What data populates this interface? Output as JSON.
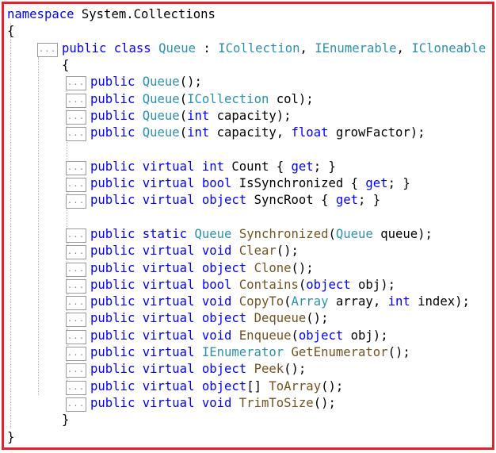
{
  "colors": {
    "keyword": "#0000ff",
    "type": "#2b91af",
    "method": "#74531f",
    "plain": "#000000",
    "border": "#e0242b"
  },
  "lines": [
    {
      "indent": 0,
      "fold": false,
      "tokens": [
        {
          "t": "namespace",
          "c": "keyword"
        },
        {
          "t": " System.Collections",
          "c": "plain"
        }
      ]
    },
    {
      "indent": 0,
      "fold": false,
      "tokens": [
        {
          "t": "{",
          "c": "plain"
        }
      ]
    },
    {
      "indent": 1,
      "fold": true,
      "tokens": [
        {
          "t": "public",
          "c": "keyword"
        },
        {
          "t": " ",
          "c": "plain"
        },
        {
          "t": "class",
          "c": "keyword"
        },
        {
          "t": " ",
          "c": "plain"
        },
        {
          "t": "Queue",
          "c": "type"
        },
        {
          "t": " : ",
          "c": "plain"
        },
        {
          "t": "ICollection",
          "c": "type"
        },
        {
          "t": ", ",
          "c": "plain"
        },
        {
          "t": "IEnumerable",
          "c": "type"
        },
        {
          "t": ", ",
          "c": "plain"
        },
        {
          "t": "ICloneable",
          "c": "type"
        }
      ]
    },
    {
      "indent": 1,
      "fold": false,
      "tokens": [
        {
          "t": "{",
          "c": "plain"
        }
      ]
    },
    {
      "indent": 2,
      "fold": true,
      "tokens": [
        {
          "t": "public",
          "c": "keyword"
        },
        {
          "t": " ",
          "c": "plain"
        },
        {
          "t": "Queue",
          "c": "type"
        },
        {
          "t": "();",
          "c": "plain"
        }
      ]
    },
    {
      "indent": 2,
      "fold": true,
      "tokens": [
        {
          "t": "public",
          "c": "keyword"
        },
        {
          "t": " ",
          "c": "plain"
        },
        {
          "t": "Queue",
          "c": "type"
        },
        {
          "t": "(",
          "c": "plain"
        },
        {
          "t": "ICollection",
          "c": "type"
        },
        {
          "t": " col);",
          "c": "plain"
        }
      ]
    },
    {
      "indent": 2,
      "fold": true,
      "tokens": [
        {
          "t": "public",
          "c": "keyword"
        },
        {
          "t": " ",
          "c": "plain"
        },
        {
          "t": "Queue",
          "c": "type"
        },
        {
          "t": "(",
          "c": "plain"
        },
        {
          "t": "int",
          "c": "keyword"
        },
        {
          "t": " capacity);",
          "c": "plain"
        }
      ]
    },
    {
      "indent": 2,
      "fold": true,
      "tokens": [
        {
          "t": "public",
          "c": "keyword"
        },
        {
          "t": " ",
          "c": "plain"
        },
        {
          "t": "Queue",
          "c": "type"
        },
        {
          "t": "(",
          "c": "plain"
        },
        {
          "t": "int",
          "c": "keyword"
        },
        {
          "t": " capacity, ",
          "c": "plain"
        },
        {
          "t": "float",
          "c": "keyword"
        },
        {
          "t": " growFactor);",
          "c": "plain"
        }
      ]
    },
    {
      "indent": 2,
      "fold": false,
      "tokens": []
    },
    {
      "indent": 2,
      "fold": true,
      "tokens": [
        {
          "t": "public",
          "c": "keyword"
        },
        {
          "t": " ",
          "c": "plain"
        },
        {
          "t": "virtual",
          "c": "keyword"
        },
        {
          "t": " ",
          "c": "plain"
        },
        {
          "t": "int",
          "c": "keyword"
        },
        {
          "t": " Count { ",
          "c": "plain"
        },
        {
          "t": "get",
          "c": "keyword"
        },
        {
          "t": "; }",
          "c": "plain"
        }
      ]
    },
    {
      "indent": 2,
      "fold": true,
      "tokens": [
        {
          "t": "public",
          "c": "keyword"
        },
        {
          "t": " ",
          "c": "plain"
        },
        {
          "t": "virtual",
          "c": "keyword"
        },
        {
          "t": " ",
          "c": "plain"
        },
        {
          "t": "bool",
          "c": "keyword"
        },
        {
          "t": " IsSynchronized { ",
          "c": "plain"
        },
        {
          "t": "get",
          "c": "keyword"
        },
        {
          "t": "; }",
          "c": "plain"
        }
      ]
    },
    {
      "indent": 2,
      "fold": true,
      "tokens": [
        {
          "t": "public",
          "c": "keyword"
        },
        {
          "t": " ",
          "c": "plain"
        },
        {
          "t": "virtual",
          "c": "keyword"
        },
        {
          "t": " ",
          "c": "plain"
        },
        {
          "t": "object",
          "c": "keyword"
        },
        {
          "t": " SyncRoot { ",
          "c": "plain"
        },
        {
          "t": "get",
          "c": "keyword"
        },
        {
          "t": "; }",
          "c": "plain"
        }
      ]
    },
    {
      "indent": 2,
      "fold": false,
      "tokens": []
    },
    {
      "indent": 2,
      "fold": true,
      "tokens": [
        {
          "t": "public",
          "c": "keyword"
        },
        {
          "t": " ",
          "c": "plain"
        },
        {
          "t": "static",
          "c": "keyword"
        },
        {
          "t": " ",
          "c": "plain"
        },
        {
          "t": "Queue",
          "c": "type"
        },
        {
          "t": " ",
          "c": "plain"
        },
        {
          "t": "Synchronized",
          "c": "method"
        },
        {
          "t": "(",
          "c": "plain"
        },
        {
          "t": "Queue",
          "c": "type"
        },
        {
          "t": " queue);",
          "c": "plain"
        }
      ]
    },
    {
      "indent": 2,
      "fold": true,
      "tokens": [
        {
          "t": "public",
          "c": "keyword"
        },
        {
          "t": " ",
          "c": "plain"
        },
        {
          "t": "virtual",
          "c": "keyword"
        },
        {
          "t": " ",
          "c": "plain"
        },
        {
          "t": "void",
          "c": "keyword"
        },
        {
          "t": " ",
          "c": "plain"
        },
        {
          "t": "Clear",
          "c": "method"
        },
        {
          "t": "();",
          "c": "plain"
        }
      ]
    },
    {
      "indent": 2,
      "fold": true,
      "tokens": [
        {
          "t": "public",
          "c": "keyword"
        },
        {
          "t": " ",
          "c": "plain"
        },
        {
          "t": "virtual",
          "c": "keyword"
        },
        {
          "t": " ",
          "c": "plain"
        },
        {
          "t": "object",
          "c": "keyword"
        },
        {
          "t": " ",
          "c": "plain"
        },
        {
          "t": "Clone",
          "c": "method"
        },
        {
          "t": "();",
          "c": "plain"
        }
      ]
    },
    {
      "indent": 2,
      "fold": true,
      "tokens": [
        {
          "t": "public",
          "c": "keyword"
        },
        {
          "t": " ",
          "c": "plain"
        },
        {
          "t": "virtual",
          "c": "keyword"
        },
        {
          "t": " ",
          "c": "plain"
        },
        {
          "t": "bool",
          "c": "keyword"
        },
        {
          "t": " ",
          "c": "plain"
        },
        {
          "t": "Contains",
          "c": "method"
        },
        {
          "t": "(",
          "c": "plain"
        },
        {
          "t": "object",
          "c": "keyword"
        },
        {
          "t": " obj);",
          "c": "plain"
        }
      ]
    },
    {
      "indent": 2,
      "fold": true,
      "tokens": [
        {
          "t": "public",
          "c": "keyword"
        },
        {
          "t": " ",
          "c": "plain"
        },
        {
          "t": "virtual",
          "c": "keyword"
        },
        {
          "t": " ",
          "c": "plain"
        },
        {
          "t": "void",
          "c": "keyword"
        },
        {
          "t": " ",
          "c": "plain"
        },
        {
          "t": "CopyTo",
          "c": "method"
        },
        {
          "t": "(",
          "c": "plain"
        },
        {
          "t": "Array",
          "c": "type"
        },
        {
          "t": " array, ",
          "c": "plain"
        },
        {
          "t": "int",
          "c": "keyword"
        },
        {
          "t": " index);",
          "c": "plain"
        }
      ]
    },
    {
      "indent": 2,
      "fold": true,
      "tokens": [
        {
          "t": "public",
          "c": "keyword"
        },
        {
          "t": " ",
          "c": "plain"
        },
        {
          "t": "virtual",
          "c": "keyword"
        },
        {
          "t": " ",
          "c": "plain"
        },
        {
          "t": "object",
          "c": "keyword"
        },
        {
          "t": " ",
          "c": "plain"
        },
        {
          "t": "Dequeue",
          "c": "method"
        },
        {
          "t": "();",
          "c": "plain"
        }
      ]
    },
    {
      "indent": 2,
      "fold": true,
      "tokens": [
        {
          "t": "public",
          "c": "keyword"
        },
        {
          "t": " ",
          "c": "plain"
        },
        {
          "t": "virtual",
          "c": "keyword"
        },
        {
          "t": " ",
          "c": "plain"
        },
        {
          "t": "void",
          "c": "keyword"
        },
        {
          "t": " ",
          "c": "plain"
        },
        {
          "t": "Enqueue",
          "c": "method"
        },
        {
          "t": "(",
          "c": "plain"
        },
        {
          "t": "object",
          "c": "keyword"
        },
        {
          "t": " obj);",
          "c": "plain"
        }
      ]
    },
    {
      "indent": 2,
      "fold": true,
      "tokens": [
        {
          "t": "public",
          "c": "keyword"
        },
        {
          "t": " ",
          "c": "plain"
        },
        {
          "t": "virtual",
          "c": "keyword"
        },
        {
          "t": " ",
          "c": "plain"
        },
        {
          "t": "IEnumerator",
          "c": "type"
        },
        {
          "t": " ",
          "c": "plain"
        },
        {
          "t": "GetEnumerator",
          "c": "method"
        },
        {
          "t": "();",
          "c": "plain"
        }
      ]
    },
    {
      "indent": 2,
      "fold": true,
      "tokens": [
        {
          "t": "public",
          "c": "keyword"
        },
        {
          "t": " ",
          "c": "plain"
        },
        {
          "t": "virtual",
          "c": "keyword"
        },
        {
          "t": " ",
          "c": "plain"
        },
        {
          "t": "object",
          "c": "keyword"
        },
        {
          "t": " ",
          "c": "plain"
        },
        {
          "t": "Peek",
          "c": "method"
        },
        {
          "t": "();",
          "c": "plain"
        }
      ]
    },
    {
      "indent": 2,
      "fold": true,
      "tokens": [
        {
          "t": "public",
          "c": "keyword"
        },
        {
          "t": " ",
          "c": "plain"
        },
        {
          "t": "virtual",
          "c": "keyword"
        },
        {
          "t": " ",
          "c": "plain"
        },
        {
          "t": "object",
          "c": "keyword"
        },
        {
          "t": "[] ",
          "c": "plain"
        },
        {
          "t": "ToArray",
          "c": "method"
        },
        {
          "t": "();",
          "c": "plain"
        }
      ]
    },
    {
      "indent": 2,
      "fold": true,
      "tokens": [
        {
          "t": "public",
          "c": "keyword"
        },
        {
          "t": " ",
          "c": "plain"
        },
        {
          "t": "virtual",
          "c": "keyword"
        },
        {
          "t": " ",
          "c": "plain"
        },
        {
          "t": "void",
          "c": "keyword"
        },
        {
          "t": " ",
          "c": "plain"
        },
        {
          "t": "TrimToSize",
          "c": "method"
        },
        {
          "t": "();",
          "c": "plain"
        }
      ]
    },
    {
      "indent": 1,
      "fold": false,
      "tokens": [
        {
          "t": "}",
          "c": "plain"
        }
      ]
    },
    {
      "indent": 0,
      "fold": false,
      "tokens": [
        {
          "t": "}",
          "c": "plain"
        }
      ]
    }
  ],
  "fold_marker": "..."
}
